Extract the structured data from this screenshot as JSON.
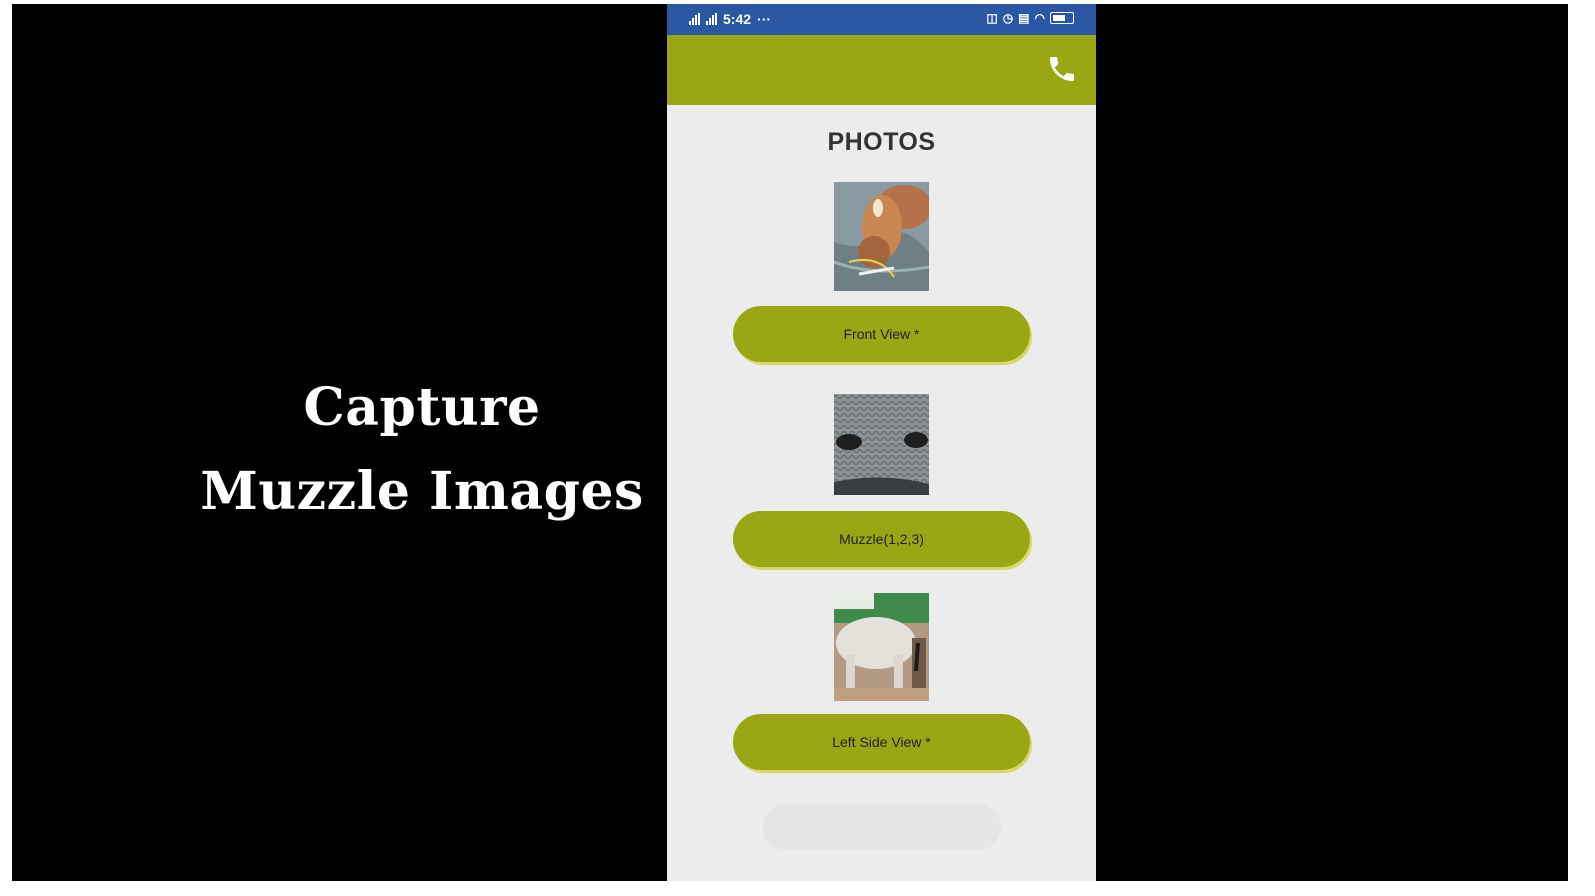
{
  "caption": {
    "line1": "Capture",
    "line2": "Muzzle Images"
  },
  "status_bar": {
    "time": "5:42",
    "more": "···",
    "signal": "4G"
  },
  "icons": {
    "call": "phone-icon",
    "battery": "battery-icon",
    "wifi": "wifi-icon",
    "alarm": "alarm-icon"
  },
  "page": {
    "title": "PHOTOS"
  },
  "photos": [
    {
      "label": "Front View *",
      "image": "cow-front-photo"
    },
    {
      "label": "Muzzle(1,2,3)",
      "image": "cow-muzzle-photo"
    },
    {
      "label": "Left Side View *",
      "image": "cow-left-side-photo"
    }
  ],
  "colors": {
    "status_bar": "#2b56a3",
    "accent": "#9aa614",
    "background": "#ececec",
    "frame": "#000000"
  }
}
